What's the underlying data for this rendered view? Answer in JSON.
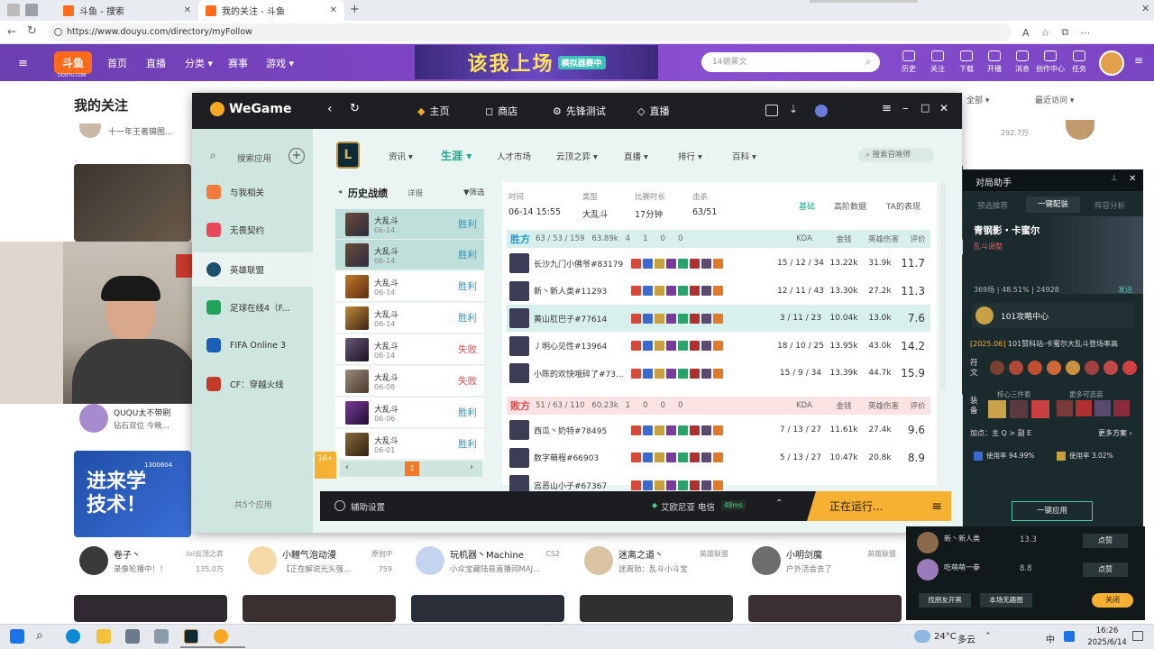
{
  "browser": {
    "tabs": [
      {
        "title": "斗鱼 - 搜索"
      },
      {
        "title": "我的关注 - 斗鱼"
      }
    ],
    "url": "https://www.douyu.com/directory/myFollow"
  },
  "douyu": {
    "logo": "斗鱼",
    "logo_sub": "DOUYU.COM",
    "nav": [
      "首页",
      "直播",
      "分类",
      "赛事",
      "游戏"
    ],
    "banner": "该我上场",
    "banner_tag": "模拟器赛中",
    "search_placeholder": "14德莱文",
    "tools": [
      "历史",
      "关注",
      "下载",
      "开播",
      "消息",
      "创作中心",
      "任务"
    ],
    "page_title": "我的关注",
    "sort_label": "最近访问",
    "top_text": "十一年王者锦图...",
    "top_count": "292.7万",
    "quuu_name": "QUQU太不带刷",
    "quuu_text": "钻石双位 今晚...",
    "streamers": [
      {
        "name": "卷子丶",
        "tag": "lol云顶之弈",
        "text": "录像轮播中！！",
        "count": "135.0万"
      },
      {
        "name": "小鲤气泡动漫",
        "tag": "原创IP",
        "text": "【正在解说光头强...",
        "count": "759"
      },
      {
        "name": "玩机器丶Machine",
        "tag": "CS2",
        "text": "小众宝藏陆县直播间MAJ...",
        "count": ""
      },
      {
        "name": "迷离之道丶",
        "tag": "英雄联盟",
        "text": "迷离勃：乱斗小斗宝",
        "count": ""
      },
      {
        "name": "小明剑魔",
        "tag": "英雄联盟",
        "text": "户外活会去了",
        "count": ""
      }
    ],
    "card_text": "进来学技术！",
    "card_sub": "1300604"
  },
  "wegame": {
    "logo": "WeGame",
    "nav": [
      "主页",
      "商店",
      "先锋测试",
      "直播"
    ],
    "sidebar": {
      "search": "搜索应用",
      "items": [
        "与我相关",
        "无畏契约",
        "英雄联盟",
        "足球在线4（F...",
        "FIFA Online 3",
        "CF：穿越火线"
      ],
      "count": "共5个应用"
    },
    "game_tabs": [
      "资讯",
      "生涯",
      "人才市场",
      "云顶之弈",
      "直播",
      "排行",
      "百科"
    ],
    "summoner_search": "搜索召唤师",
    "history": {
      "title": "历史战绩",
      "sub": "详报",
      "filter": "筛选",
      "rows": [
        {
          "mode": "大乱斗",
          "date": "06-14",
          "result": "胜利"
        },
        {
          "mode": "大乱斗",
          "date": "06-14",
          "result": "胜利"
        },
        {
          "mode": "大乱斗",
          "date": "06-14",
          "result": "胜利"
        },
        {
          "mode": "大乱斗",
          "date": "06-14",
          "result": "胜利"
        },
        {
          "mode": "大乱斗",
          "date": "06-14",
          "result": "失败"
        },
        {
          "mode": "大乱斗",
          "date": "06-08",
          "result": "失败"
        },
        {
          "mode": "大乱斗",
          "date": "06-06",
          "result": "胜利"
        },
        {
          "mode": "大乱斗",
          "date": "06-01",
          "result": "胜利"
        }
      ],
      "page": "1",
      "age": "16+"
    },
    "detail": {
      "meta_labels": [
        "时间",
        "类型",
        "比赛时长",
        "击杀"
      ],
      "meta_values": [
        "06-14 15:55",
        "大乱斗",
        "17分钟",
        "63/51"
      ],
      "view_tabs": [
        "基础",
        "高阶数据",
        "TA的表现"
      ],
      "win_team": {
        "label": "胜方",
        "kda": "63 / 53 / 159",
        "gold": "63.89k",
        "towers": "4",
        "dragons": "1",
        "barons": "0",
        "heralds": "0"
      },
      "lose_team": {
        "label": "败方",
        "kda": "51 / 63 / 110",
        "gold": "60.23k",
        "towers": "1",
        "dragons": "0",
        "barons": "0",
        "heralds": "0"
      },
      "col_kda": "KDA",
      "col_gold": "金钱",
      "col_dmg": "英雄伤害",
      "col_score": "评价",
      "win_players": [
        {
          "name": "长沙九门小佛爷#83179",
          "kda": "15 / 12 / 34",
          "gold": "13.22k",
          "dmg": "31.9k",
          "score": "11.7"
        },
        {
          "name": "新丶新人类#11293",
          "kda": "12 / 11 / 43",
          "gold": "13.30k",
          "dmg": "27.2k",
          "score": "11.3"
        },
        {
          "name": "黄山肛巴子#77614",
          "kda": "3 / 11 / 23",
          "gold": "10.04k",
          "dmg": "13.0k",
          "score": "7.6"
        },
        {
          "name": "丿明心见性#13964",
          "kda": "18 / 10 / 25",
          "gold": "13.95k",
          "dmg": "43.0k",
          "score": "14.2"
        },
        {
          "name": "小陈的欢快哦碎了#73...",
          "kda": "15 / 9 / 34",
          "gold": "13.39k",
          "dmg": "44.7k",
          "score": "15.9"
        }
      ],
      "lose_players": [
        {
          "name": "西瓜丶奶特#78495",
          "kda": "7 / 13 / 27",
          "gold": "11.61k",
          "dmg": "27.4k",
          "score": "9.6"
        },
        {
          "name": "数字萌程#66903",
          "kda": "5 / 13 / 27",
          "gold": "10.47k",
          "dmg": "20.8k",
          "score": "8.9"
        },
        {
          "name": "宫恶山小子#67367",
          "kda": "",
          "gold": "",
          "dmg": "",
          "score": ""
        }
      ]
    },
    "bottom": {
      "assist": "辅助设置",
      "server": "艾欧尼亚 电信",
      "ping": "48ms",
      "running": "正在运行..."
    }
  },
  "assistant": {
    "title": "对局助手",
    "tabs": [
      "预选推荐",
      "一键配装",
      "阵容分析"
    ],
    "champ": "青钢影・卡蜜尔",
    "champ_sub": "乱斗调整",
    "stats": "369场 | 48.51% | 24928",
    "send": "发送",
    "source": "101攻略中心",
    "version": "[2025.06]",
    "version_text": "101赞科站-卡蜜尔大乱斗登场率高",
    "rune": "符文",
    "equip": "装备",
    "core": "核心三件套",
    "more": "更多可选装",
    "add": "加点：主 Q > 副 E",
    "more_plans": "更多方案",
    "rate1": "使用率 94.99%",
    "rate2": "使用率 3.02%",
    "apply": "一键应用",
    "players": [
      {
        "name": "新丶新人类",
        "score": "13.3",
        "btn": "点赞"
      },
      {
        "name": "吃萌萌一拳",
        "score": "8.8",
        "btn": "点赞"
      }
    ],
    "btn_find": "找朋友开黑",
    "btn_hide": "本场无趣图",
    "btn_close": "关闭"
  },
  "taskbar": {
    "weather": "24°C",
    "weather_desc": "多云",
    "ime": "中",
    "time": "16:26",
    "date": "2025/6/14"
  },
  "colors": {
    "win": "#1e9bd7",
    "lose": "#e04848",
    "accent_teal": "#21a88f",
    "running": "#f6b132",
    "douyu_purple": "#7d45c4"
  }
}
